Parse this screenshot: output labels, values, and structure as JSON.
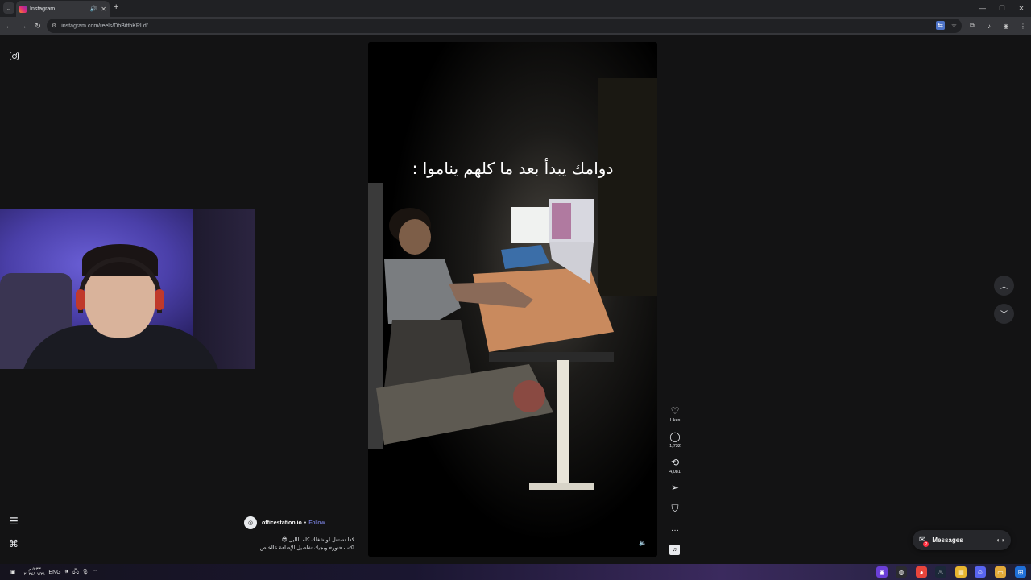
{
  "browser": {
    "tab": {
      "title": "Instagram"
    },
    "url": "instagram.com/reels/DbBittbKRLd/"
  },
  "icons": {
    "tab_menu": "chevron-down-icon",
    "tab_close": "close-icon",
    "new_tab": "plus-icon",
    "back": "arrow-left-icon",
    "forward": "arrow-right-icon",
    "reload": "reload-icon",
    "site_info": "tune-icon",
    "bookmark": "star-icon",
    "instagram": "instagram-icon",
    "menu": "hamburger-icon",
    "meta": "meta-icon"
  },
  "reel": {
    "overlay_text": "دوامك يبدأ بعد ما كلهم يناموا :",
    "likes_label": "Likes",
    "comments_count": "1,732",
    "reposts_count": "4,081"
  },
  "author": {
    "username": "officestation.io",
    "separator": "•",
    "follow_label": "Follow",
    "caption_line1": "كذا تشتغل لو شغلك كله بالليل 😎",
    "caption_line2": "اكتب «نور» وبجيك تفاصيل الإضاءة عالخاص."
  },
  "messages": {
    "label": "Messages",
    "badge": "2"
  },
  "taskbar": {
    "time": "٥:٣٣ م",
    "date": "٢٠٢٤/٠٧/٢١",
    "lang": "ENG"
  },
  "colors": {
    "background": "#131314",
    "follow_link": "#8a93ff",
    "notification_badge": "#ff3040"
  }
}
